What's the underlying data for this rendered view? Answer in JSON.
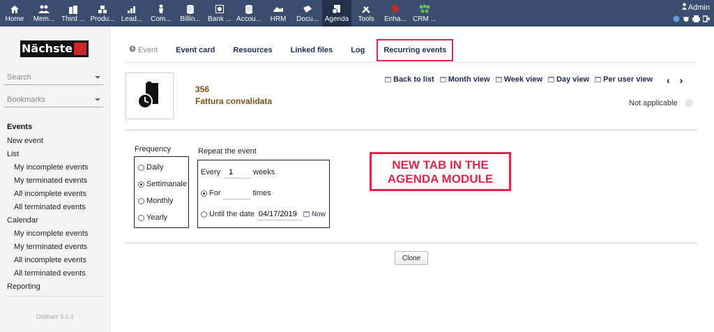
{
  "topmenu": [
    {
      "label": "Home",
      "icon": "home-icon"
    },
    {
      "label": "Mem...",
      "icon": "members-icon"
    },
    {
      "label": "Third ...",
      "icon": "company-icon"
    },
    {
      "label": "Produ...",
      "icon": "products-icon"
    },
    {
      "label": "Lead...",
      "icon": "leads-icon"
    },
    {
      "label": "Com...",
      "icon": "commercial-icon"
    },
    {
      "label": "Billin...",
      "icon": "billing-icon"
    },
    {
      "label": "Bank ...",
      "icon": "bank-icon"
    },
    {
      "label": "Accou...",
      "icon": "accounting-icon"
    },
    {
      "label": "HRM",
      "icon": "hrm-icon"
    },
    {
      "label": "Docu...",
      "icon": "documents-icon"
    },
    {
      "label": "Agenda",
      "icon": "agenda-icon",
      "active": true
    },
    {
      "label": "Tools",
      "icon": "tools-icon"
    },
    {
      "label": "Enha...",
      "icon": "enhance-icon"
    },
    {
      "label": "CRM ...",
      "icon": "crm-icon"
    }
  ],
  "user": {
    "name": "Admin"
  },
  "sidebar": {
    "logo_text": "Nächste",
    "search_label": "Search",
    "bookmarks_label": "Bookmarks",
    "menu": [
      {
        "label": "Events",
        "level": "head"
      },
      {
        "label": "New event",
        "level": 0
      },
      {
        "label": "List",
        "level": 0
      },
      {
        "label": "My incomplete events",
        "level": 1
      },
      {
        "label": "My terminated events",
        "level": 1
      },
      {
        "label": "All incomplete events",
        "level": 1
      },
      {
        "label": "All terminated events",
        "level": 1
      },
      {
        "label": "Calendar",
        "level": 0
      },
      {
        "label": "My incomplete events",
        "level": 1
      },
      {
        "label": "My terminated events",
        "level": 1
      },
      {
        "label": "All incomplete events",
        "level": 1
      },
      {
        "label": "All terminated events",
        "level": 1
      },
      {
        "label": "Reporting",
        "level": 0
      }
    ],
    "version": "Dolibarr 9.0.1"
  },
  "tabs": {
    "event": "Event",
    "event_card": "Event card",
    "resources": "Resources",
    "linked_files": "Linked files",
    "log": "Log",
    "recurring": "Recurring events"
  },
  "object": {
    "ref": "356",
    "label": "Fattura convalidata"
  },
  "nav": {
    "back": "Back to list",
    "month": "Month view",
    "week": "Week view",
    "day": "Day view",
    "per_user": "Per user view"
  },
  "status": "Not applicable",
  "frequency": {
    "label": "Frequency",
    "options": [
      {
        "label": "Daily",
        "checked": false
      },
      {
        "label": "Settimanale",
        "checked": true
      },
      {
        "label": "Monthly",
        "checked": false
      },
      {
        "label": "Yearly",
        "checked": false
      }
    ]
  },
  "repeat": {
    "label": "Repeat the event",
    "every": "Every",
    "every_value": "1",
    "every_unit": "weeks",
    "for": "For",
    "for_value": "",
    "for_unit": "times",
    "until": "Until the date",
    "until_value": "04/17/2019",
    "now": "Now"
  },
  "annotation": {
    "line1": "NEW TAB IN THE",
    "line2": "AGENDA MODULE"
  },
  "clone_label": "Clone"
}
